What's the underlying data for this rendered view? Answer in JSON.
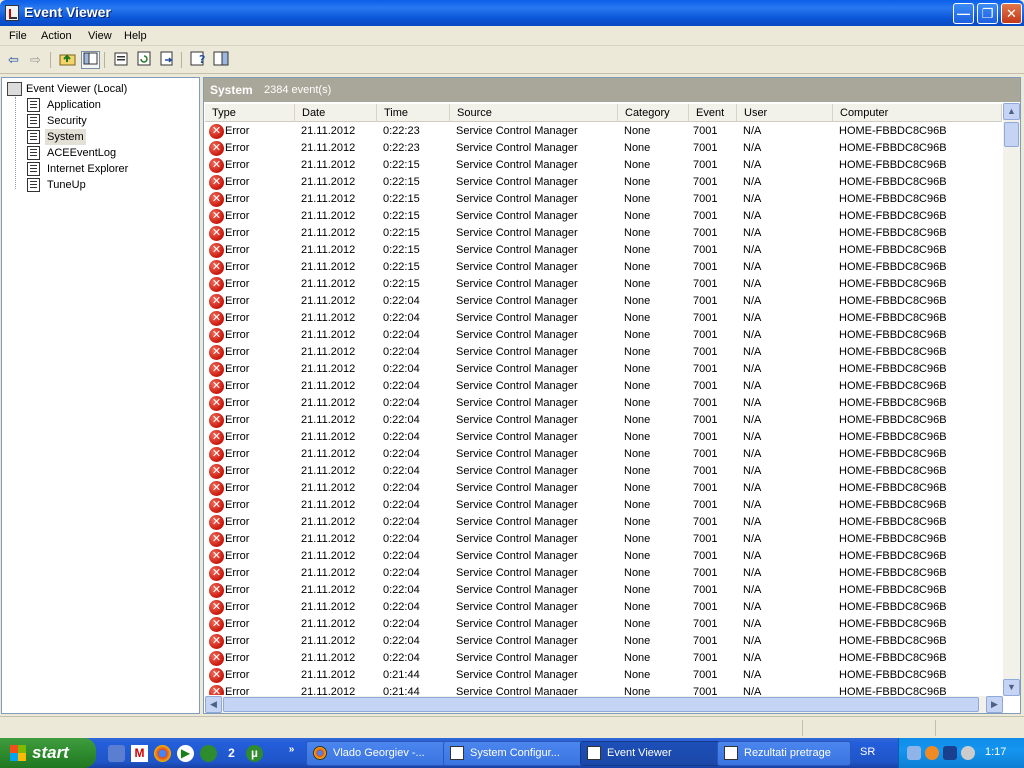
{
  "window": {
    "title": "Event Viewer",
    "min_glyph": "—",
    "max_glyph": "❐",
    "close_glyph": "✕"
  },
  "menu": [
    "File",
    "Action",
    "View",
    "Help"
  ],
  "toolbar": {
    "back_glyph": "⇦",
    "forward_glyph": "⇨"
  },
  "tree": {
    "root": "Event Viewer (Local)",
    "items": [
      {
        "label": "Application",
        "selected": false
      },
      {
        "label": "Security",
        "selected": false
      },
      {
        "label": "System",
        "selected": true
      },
      {
        "label": "ACEEventLog",
        "selected": false
      },
      {
        "label": "Internet Explorer",
        "selected": false
      },
      {
        "label": "TuneUp",
        "selected": false
      }
    ]
  },
  "pane": {
    "title": "System",
    "count": "2384 event(s)",
    "columns": [
      "Type",
      "Date",
      "Time",
      "Source",
      "Category",
      "Event",
      "User",
      "Computer"
    ],
    "rows": [
      [
        "Error",
        "21.11.2012",
        "0:22:23",
        "Service Control Manager",
        "None",
        "7001",
        "N/A",
        "HOME-FBBDC8C96B"
      ],
      [
        "Error",
        "21.11.2012",
        "0:22:23",
        "Service Control Manager",
        "None",
        "7001",
        "N/A",
        "HOME-FBBDC8C96B"
      ],
      [
        "Error",
        "21.11.2012",
        "0:22:15",
        "Service Control Manager",
        "None",
        "7001",
        "N/A",
        "HOME-FBBDC8C96B"
      ],
      [
        "Error",
        "21.11.2012",
        "0:22:15",
        "Service Control Manager",
        "None",
        "7001",
        "N/A",
        "HOME-FBBDC8C96B"
      ],
      [
        "Error",
        "21.11.2012",
        "0:22:15",
        "Service Control Manager",
        "None",
        "7001",
        "N/A",
        "HOME-FBBDC8C96B"
      ],
      [
        "Error",
        "21.11.2012",
        "0:22:15",
        "Service Control Manager",
        "None",
        "7001",
        "N/A",
        "HOME-FBBDC8C96B"
      ],
      [
        "Error",
        "21.11.2012",
        "0:22:15",
        "Service Control Manager",
        "None",
        "7001",
        "N/A",
        "HOME-FBBDC8C96B"
      ],
      [
        "Error",
        "21.11.2012",
        "0:22:15",
        "Service Control Manager",
        "None",
        "7001",
        "N/A",
        "HOME-FBBDC8C96B"
      ],
      [
        "Error",
        "21.11.2012",
        "0:22:15",
        "Service Control Manager",
        "None",
        "7001",
        "N/A",
        "HOME-FBBDC8C96B"
      ],
      [
        "Error",
        "21.11.2012",
        "0:22:15",
        "Service Control Manager",
        "None",
        "7001",
        "N/A",
        "HOME-FBBDC8C96B"
      ],
      [
        "Error",
        "21.11.2012",
        "0:22:04",
        "Service Control Manager",
        "None",
        "7001",
        "N/A",
        "HOME-FBBDC8C96B"
      ],
      [
        "Error",
        "21.11.2012",
        "0:22:04",
        "Service Control Manager",
        "None",
        "7001",
        "N/A",
        "HOME-FBBDC8C96B"
      ],
      [
        "Error",
        "21.11.2012",
        "0:22:04",
        "Service Control Manager",
        "None",
        "7001",
        "N/A",
        "HOME-FBBDC8C96B"
      ],
      [
        "Error",
        "21.11.2012",
        "0:22:04",
        "Service Control Manager",
        "None",
        "7001",
        "N/A",
        "HOME-FBBDC8C96B"
      ],
      [
        "Error",
        "21.11.2012",
        "0:22:04",
        "Service Control Manager",
        "None",
        "7001",
        "N/A",
        "HOME-FBBDC8C96B"
      ],
      [
        "Error",
        "21.11.2012",
        "0:22:04",
        "Service Control Manager",
        "None",
        "7001",
        "N/A",
        "HOME-FBBDC8C96B"
      ],
      [
        "Error",
        "21.11.2012",
        "0:22:04",
        "Service Control Manager",
        "None",
        "7001",
        "N/A",
        "HOME-FBBDC8C96B"
      ],
      [
        "Error",
        "21.11.2012",
        "0:22:04",
        "Service Control Manager",
        "None",
        "7001",
        "N/A",
        "HOME-FBBDC8C96B"
      ],
      [
        "Error",
        "21.11.2012",
        "0:22:04",
        "Service Control Manager",
        "None",
        "7001",
        "N/A",
        "HOME-FBBDC8C96B"
      ],
      [
        "Error",
        "21.11.2012",
        "0:22:04",
        "Service Control Manager",
        "None",
        "7001",
        "N/A",
        "HOME-FBBDC8C96B"
      ],
      [
        "Error",
        "21.11.2012",
        "0:22:04",
        "Service Control Manager",
        "None",
        "7001",
        "N/A",
        "HOME-FBBDC8C96B"
      ],
      [
        "Error",
        "21.11.2012",
        "0:22:04",
        "Service Control Manager",
        "None",
        "7001",
        "N/A",
        "HOME-FBBDC8C96B"
      ],
      [
        "Error",
        "21.11.2012",
        "0:22:04",
        "Service Control Manager",
        "None",
        "7001",
        "N/A",
        "HOME-FBBDC8C96B"
      ],
      [
        "Error",
        "21.11.2012",
        "0:22:04",
        "Service Control Manager",
        "None",
        "7001",
        "N/A",
        "HOME-FBBDC8C96B"
      ],
      [
        "Error",
        "21.11.2012",
        "0:22:04",
        "Service Control Manager",
        "None",
        "7001",
        "N/A",
        "HOME-FBBDC8C96B"
      ],
      [
        "Error",
        "21.11.2012",
        "0:22:04",
        "Service Control Manager",
        "None",
        "7001",
        "N/A",
        "HOME-FBBDC8C96B"
      ],
      [
        "Error",
        "21.11.2012",
        "0:22:04",
        "Service Control Manager",
        "None",
        "7001",
        "N/A",
        "HOME-FBBDC8C96B"
      ],
      [
        "Error",
        "21.11.2012",
        "0:22:04",
        "Service Control Manager",
        "None",
        "7001",
        "N/A",
        "HOME-FBBDC8C96B"
      ],
      [
        "Error",
        "21.11.2012",
        "0:22:04",
        "Service Control Manager",
        "None",
        "7001",
        "N/A",
        "HOME-FBBDC8C96B"
      ],
      [
        "Error",
        "21.11.2012",
        "0:22:04",
        "Service Control Manager",
        "None",
        "7001",
        "N/A",
        "HOME-FBBDC8C96B"
      ],
      [
        "Error",
        "21.11.2012",
        "0:22:04",
        "Service Control Manager",
        "None",
        "7001",
        "N/A",
        "HOME-FBBDC8C96B"
      ],
      [
        "Error",
        "21.11.2012",
        "0:22:04",
        "Service Control Manager",
        "None",
        "7001",
        "N/A",
        "HOME-FBBDC8C96B"
      ],
      [
        "Error",
        "21.11.2012",
        "0:21:44",
        "Service Control Manager",
        "None",
        "7001",
        "N/A",
        "HOME-FBBDC8C96B"
      ],
      [
        "Error",
        "21.11.2012",
        "0:21:44",
        "Service Control Manager",
        "None",
        "7001",
        "N/A",
        "HOME-FBBDC8C96B"
      ]
    ]
  },
  "taskbar": {
    "start": "start",
    "tasks": [
      {
        "label": "Vlado Georgiev -...",
        "active": false
      },
      {
        "label": "System Configur...",
        "active": false
      },
      {
        "label": "Event Viewer",
        "active": true
      },
      {
        "label": "Rezultati pretrage",
        "active": false
      }
    ],
    "language": "SR",
    "clock": "1:17"
  },
  "colors": {
    "error": "#c8150a",
    "title_bar": "#0a5ee8",
    "pane_header": "#a9a69a"
  }
}
